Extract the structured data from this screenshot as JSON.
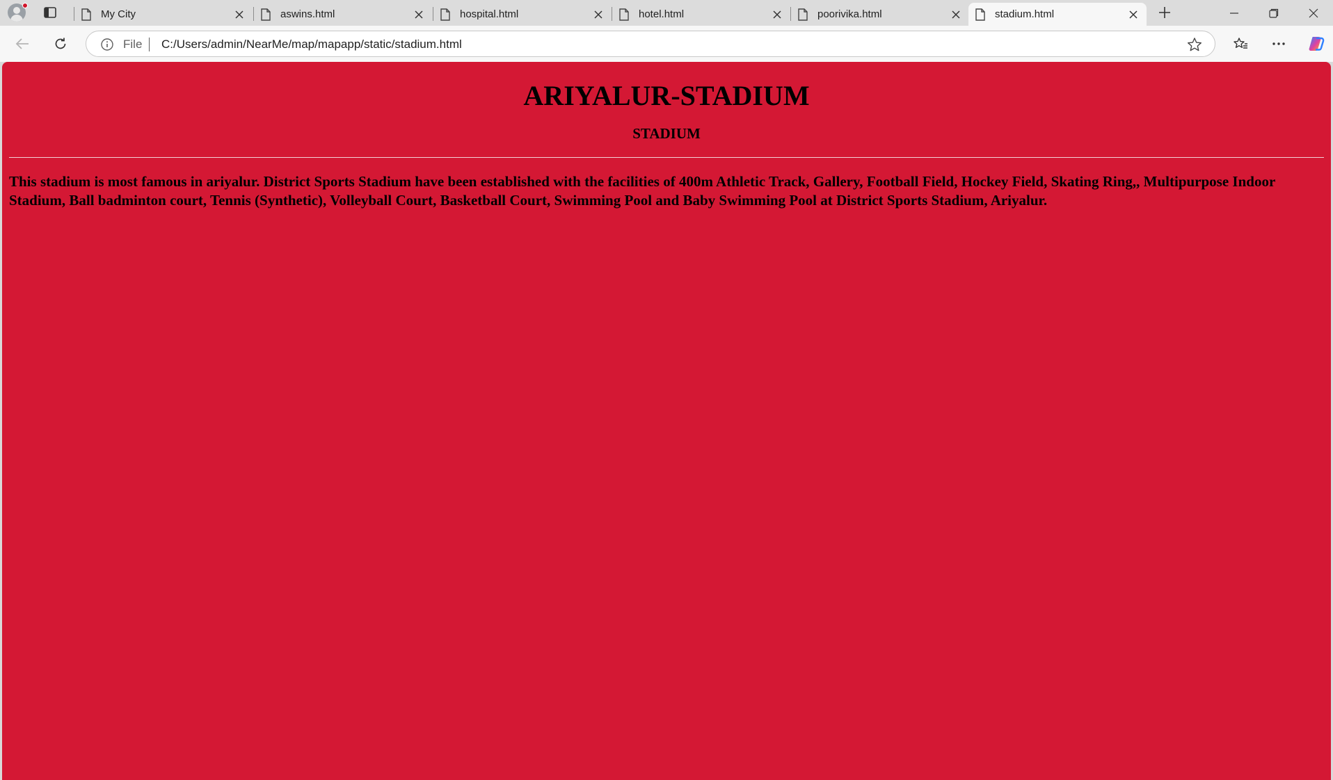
{
  "browser": {
    "tabs": [
      {
        "title": "My City",
        "active": false
      },
      {
        "title": "aswins.html",
        "active": false
      },
      {
        "title": "hospital.html",
        "active": false
      },
      {
        "title": "hotel.html",
        "active": false
      },
      {
        "title": "poorivika.html",
        "active": false
      },
      {
        "title": "stadium.html",
        "active": true
      }
    ],
    "address_bar": {
      "scheme_label": "File",
      "url": "C:/Users/admin/NearMe/map/mapapp/static/stadium.html"
    },
    "colors": {
      "profile_badge": "#d0152a",
      "copilot_gradient": [
        "#2f80ff",
        "#e040a0",
        "#ffb020"
      ]
    }
  },
  "page": {
    "background_color": "#d41834",
    "title": "ARIYALUR-STADIUM",
    "subtitle": "STADIUM",
    "description": "This stadium is most famous in ariyalur. District Sports Stadium have been established with the facilities of 400m Athletic Track, Gallery, Football Field, Hockey Field, Skating Ring,, Multipurpose Indoor Stadium, Ball badminton court, Tennis (Synthetic), Volleyball Court, Basketball Court, Swimming Pool and Baby Swimming Pool at District Sports Stadium, Ariyalur."
  }
}
